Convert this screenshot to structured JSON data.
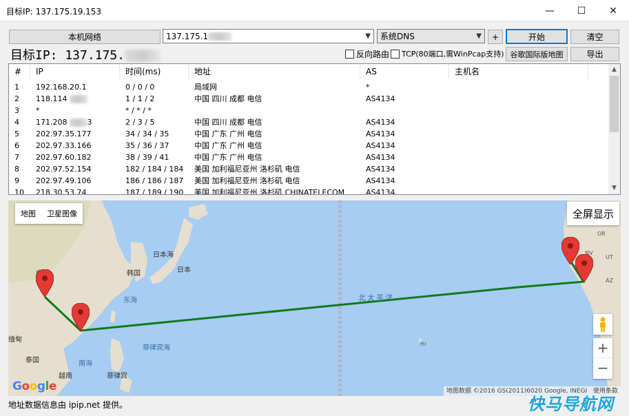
{
  "window": {
    "title": "目标IP: 137.175.19.153",
    "minimize_glyph": "—",
    "maximize_glyph": "☐",
    "close_glyph": "✕"
  },
  "toolbar": {
    "local_network_label": "本机网络",
    "ip_input_value": "137.175.1",
    "dns_select_value": "系统DNS",
    "plus_label": "+",
    "start_label": "开始",
    "clear_label": "清空",
    "target_label": "目标IP: 137.175.",
    "reverse_route_label": "反向路由",
    "tcp_label": "TCP(80端口,需WinPcap支持)",
    "google_map_label": "谷歌国际版地图",
    "export_label": "导出"
  },
  "table": {
    "columns": [
      "#",
      "IP",
      "时间(ms)",
      "地址",
      "AS",
      "主机名"
    ],
    "rows": [
      {
        "n": "1",
        "ip": "192.168.20.1",
        "ip_blur": false,
        "time": "0 / 0 / 0",
        "addr": "局域网",
        "as": "*"
      },
      {
        "n": "2",
        "ip": "118.114",
        "ip_blur": true,
        "time": "1 / 1 / 2",
        "addr": "中国 四川 成都 电信",
        "as": "AS4134"
      },
      {
        "n": "3",
        "ip": "*",
        "ip_blur": false,
        "time": "* / * / *",
        "addr": "",
        "as": ""
      },
      {
        "n": "4",
        "ip": "171.208",
        "ip_blur": true,
        "ip_tail": "3",
        "time": "2 / 3 / 5",
        "addr": "中国 四川 成都 电信",
        "as": "AS4134"
      },
      {
        "n": "5",
        "ip": "202.97.35.177",
        "ip_blur": false,
        "time": "34 / 34 / 35",
        "addr": "中国 广东 广州 电信",
        "as": "AS4134"
      },
      {
        "n": "6",
        "ip": "202.97.33.166",
        "ip_blur": false,
        "time": "35 / 36 / 37",
        "addr": "中国 广东 广州 电信",
        "as": "AS4134"
      },
      {
        "n": "7",
        "ip": "202.97.60.182",
        "ip_blur": false,
        "time": "38 / 39 / 41",
        "addr": "中国 广东 广州 电信",
        "as": "AS4134"
      },
      {
        "n": "8",
        "ip": "202.97.52.154",
        "ip_blur": false,
        "time": "182 / 184 / 184",
        "addr": "美国 加利福尼亚州 洛杉矶 电信",
        "as": "AS4134"
      },
      {
        "n": "9",
        "ip": "202.97.49.106",
        "ip_blur": false,
        "time": "186 / 186 / 187",
        "addr": "美国 加利福尼亚州 洛杉矶 电信",
        "as": "AS4134"
      },
      {
        "n": "10",
        "ip": "218.30.53.74",
        "ip_blur": false,
        "time": "187 / 189 / 190",
        "addr": "美国 加利福尼亚州 洛杉矶 CHINATELECOM",
        "as": "AS4134"
      }
    ]
  },
  "map": {
    "tab_map": "地图",
    "tab_satellite": "卫星图像",
    "fullscreen_label": "全屏显示",
    "zoom_in": "+",
    "zoom_out": "−",
    "attribution": "地图数据 ©2016 GS(2011)6020 Google, INEGI",
    "terms": "使用条款",
    "google_logo": "Google",
    "labels": {
      "china": "中国",
      "japan_sea": "日本海",
      "japan": "日本",
      "korea": "韩国",
      "east_sea": "东海",
      "pacific": "北太平洋",
      "philippine_sea": "菲律宾海",
      "myanmar": "缅甸",
      "thailand": "泰国",
      "south_sea": "南海",
      "vietnam": "越南",
      "philippines": "菲律宾",
      "hi": "HI",
      "or": "OR",
      "nv": "NV",
      "ut": "UT",
      "az": "AZ",
      "ca": "C"
    },
    "route_color": "#0f7a1a",
    "ocean_color": "#a7cdf2",
    "land_color": "#e8e2d4"
  },
  "footer": {
    "text": "地址数据信息由 ipip.net 提供。"
  },
  "watermark": {
    "text": "快马导航网"
  }
}
